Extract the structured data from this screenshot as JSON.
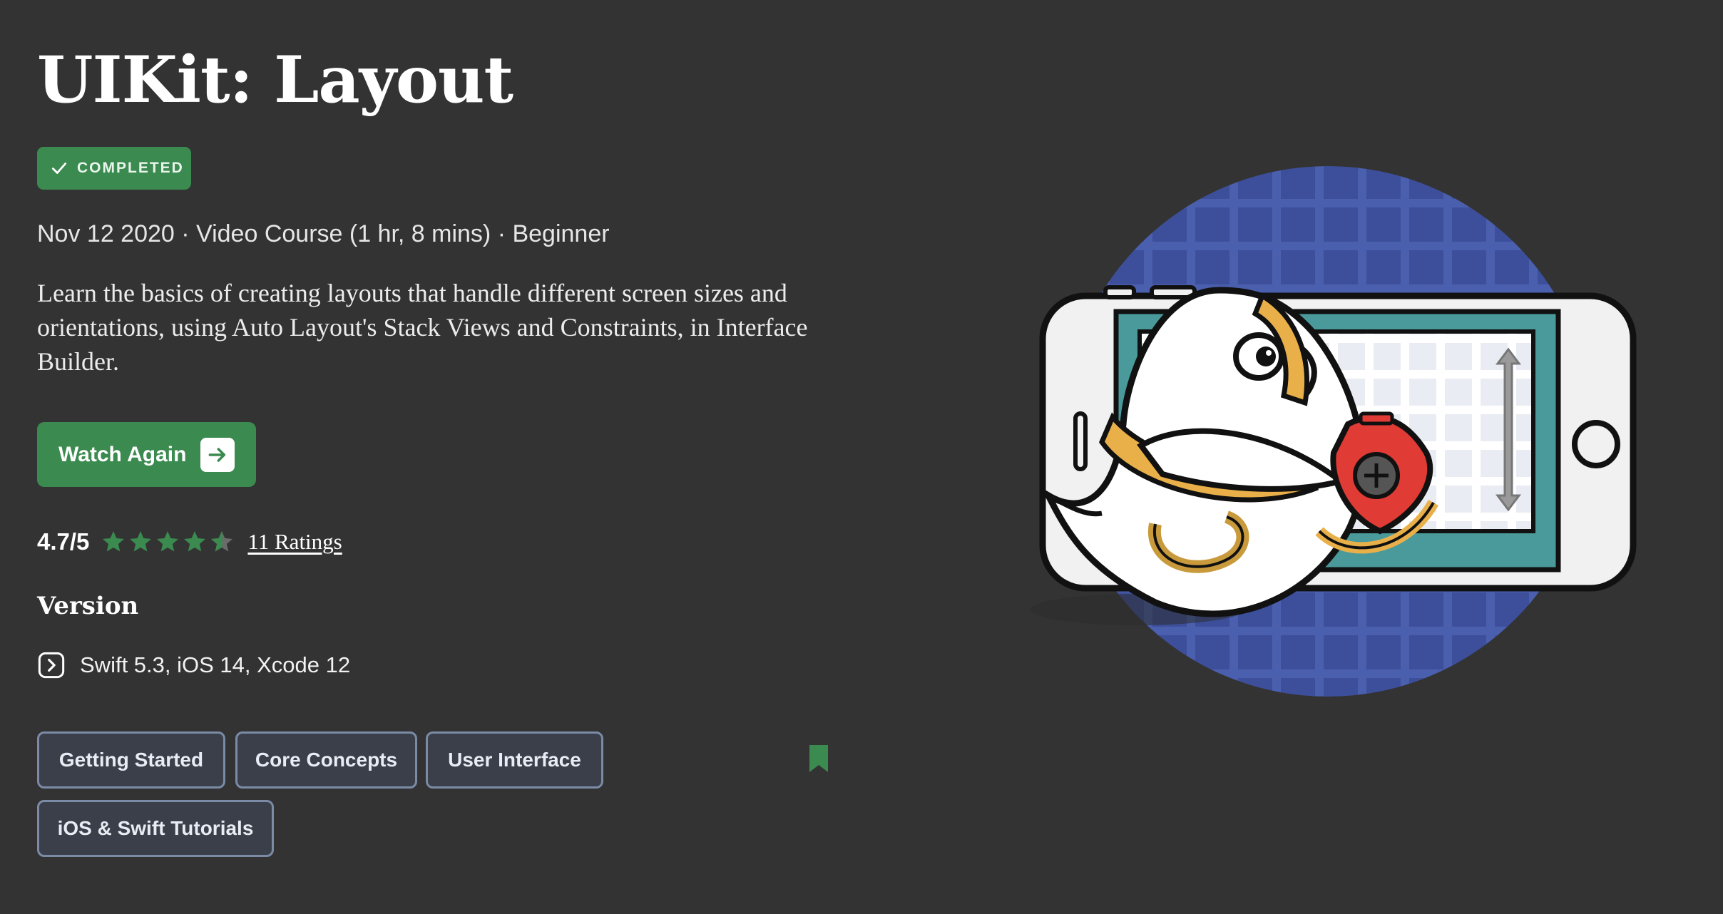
{
  "course": {
    "title": "UIKit: Layout",
    "status_badge": "COMPLETED",
    "meta": "Nov 12 2020 · Video Course (1 hr, 8 mins) · Beginner",
    "description": "Learn the basics of creating layouts that handle different screen sizes and orientations, using Auto Layout's Stack Views and Constraints, in Interface Builder."
  },
  "actions": {
    "watch_label": "Watch Again"
  },
  "rating": {
    "score": "4.7/5",
    "stars_filled": 4.7,
    "stars_total": 5,
    "count_label": "11 Ratings"
  },
  "version": {
    "heading": "Version",
    "details": "Swift 5.3, iOS 14, Xcode 12"
  },
  "tags": [
    "Getting Started",
    "Core Concepts",
    "User Interface",
    "iOS & Swift Tutorials"
  ],
  "icons": {
    "badge": "checkmark-icon",
    "watch": "arrow-right-icon",
    "version": "chevron-right-icon",
    "bookmark": "bookmark-icon"
  },
  "colors": {
    "background": "#333333",
    "accent_green": "#3b8a4f",
    "tag_border": "#7b8ba6",
    "circle_blue": "#4a5fae"
  }
}
